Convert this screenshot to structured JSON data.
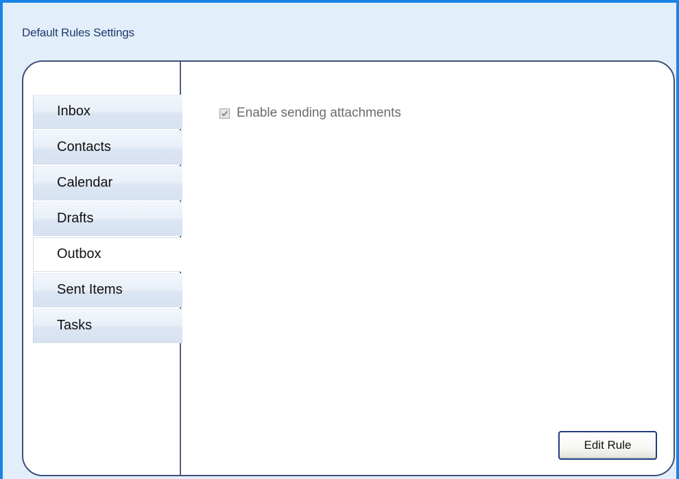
{
  "dialog": {
    "title": "Default Rules Settings"
  },
  "tabs": [
    {
      "label": "Inbox",
      "selected": false
    },
    {
      "label": "Contacts",
      "selected": false
    },
    {
      "label": "Calendar",
      "selected": false
    },
    {
      "label": "Drafts",
      "selected": false
    },
    {
      "label": "Outbox",
      "selected": true
    },
    {
      "label": "Sent Items",
      "selected": false
    },
    {
      "label": "Tasks",
      "selected": false
    }
  ],
  "content": {
    "option_label": "Enable sending attachments",
    "option_checked": true,
    "option_disabled": true,
    "edit_button_label": "Edit Rule"
  },
  "colors": {
    "accent_border": "#1a84e6",
    "panel_border": "#3e5075",
    "background": "#e3eefb"
  }
}
